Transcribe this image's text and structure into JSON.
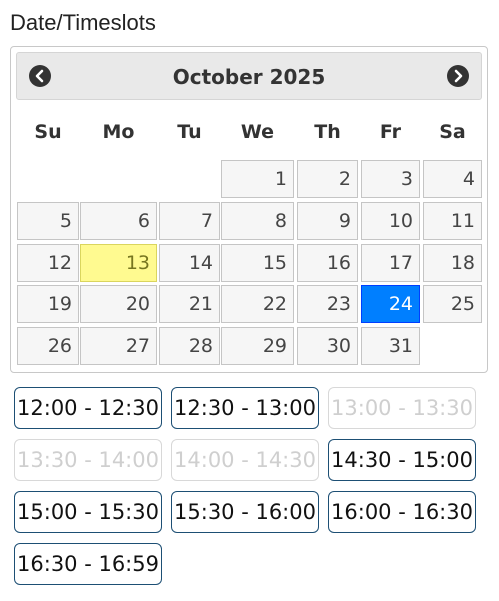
{
  "section_title": "Date/Timeslots",
  "calendar": {
    "month_label": "October 2025",
    "weekdays": [
      "Su",
      "Mo",
      "Tu",
      "We",
      "Th",
      "Fr",
      "Sa"
    ],
    "weeks": [
      [
        "",
        "",
        "",
        "1",
        "2",
        "3",
        "4"
      ],
      [
        "5",
        "6",
        "7",
        "8",
        "9",
        "10",
        "11"
      ],
      [
        "12",
        "13",
        "14",
        "15",
        "16",
        "17",
        "18"
      ],
      [
        "19",
        "20",
        "21",
        "22",
        "23",
        "24",
        "25"
      ],
      [
        "26",
        "27",
        "28",
        "29",
        "30",
        "31",
        ""
      ]
    ],
    "today": "13",
    "selected": "24",
    "prev_icon": "chevron-left-circle-icon",
    "next_icon": "chevron-right-circle-icon"
  },
  "timeslots": [
    {
      "label": "12:00 - 12:30",
      "available": true
    },
    {
      "label": "12:30 - 13:00",
      "available": true
    },
    {
      "label": "13:00 - 13:30",
      "available": false
    },
    {
      "label": "13:30 - 14:00",
      "available": false
    },
    {
      "label": "14:00 - 14:30",
      "available": false
    },
    {
      "label": "14:30 - 15:00",
      "available": true
    },
    {
      "label": "15:00 - 15:30",
      "available": true
    },
    {
      "label": "15:30 - 16:00",
      "available": true
    },
    {
      "label": "16:00 - 16:30",
      "available": true
    },
    {
      "label": "16:30 - 16:59",
      "available": true
    }
  ],
  "colors": {
    "today_highlight": "#fffa90",
    "selected_highlight": "#007fff",
    "slot_border": "#1d4f74",
    "slot_disabled": "#d8d8d8"
  }
}
